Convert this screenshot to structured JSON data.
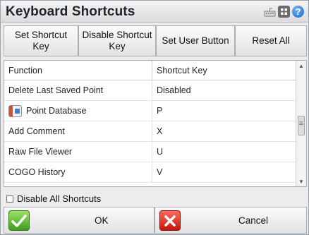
{
  "window": {
    "title": "Keyboard Shortcuts",
    "icons": [
      "keyboard-icon",
      "grid-icon",
      "help-icon"
    ],
    "help_glyph": "?"
  },
  "toolbar": {
    "set_shortcut_label": "Set Shortcut\nKey",
    "disable_shortcut_label": "Disable Shortcut\nKey",
    "set_user_button_label": "Set User Button",
    "reset_all_label": "Reset All"
  },
  "table": {
    "headers": {
      "function": "Function",
      "shortcut": "Shortcut Key"
    },
    "rows": [
      {
        "function": "Delete Last Saved Point",
        "shortcut": "Disabled",
        "icon": ""
      },
      {
        "function": "Point Database",
        "shortcut": "P",
        "icon": "point-database-icon"
      },
      {
        "function": "Add Comment",
        "shortcut": "X",
        "icon": ""
      },
      {
        "function": "Raw File Viewer",
        "shortcut": "U",
        "icon": ""
      },
      {
        "function": "COGO History",
        "shortcut": "V",
        "icon": ""
      }
    ]
  },
  "options": {
    "disable_all_label": "Disable All Shortcuts",
    "disable_all_checked": false
  },
  "footer": {
    "ok_label": "OK",
    "cancel_label": "Cancel"
  },
  "colors": {
    "ok_green": "#3f9b1f",
    "cancel_red": "#c0180f",
    "help_blue": "#1e67c8"
  }
}
